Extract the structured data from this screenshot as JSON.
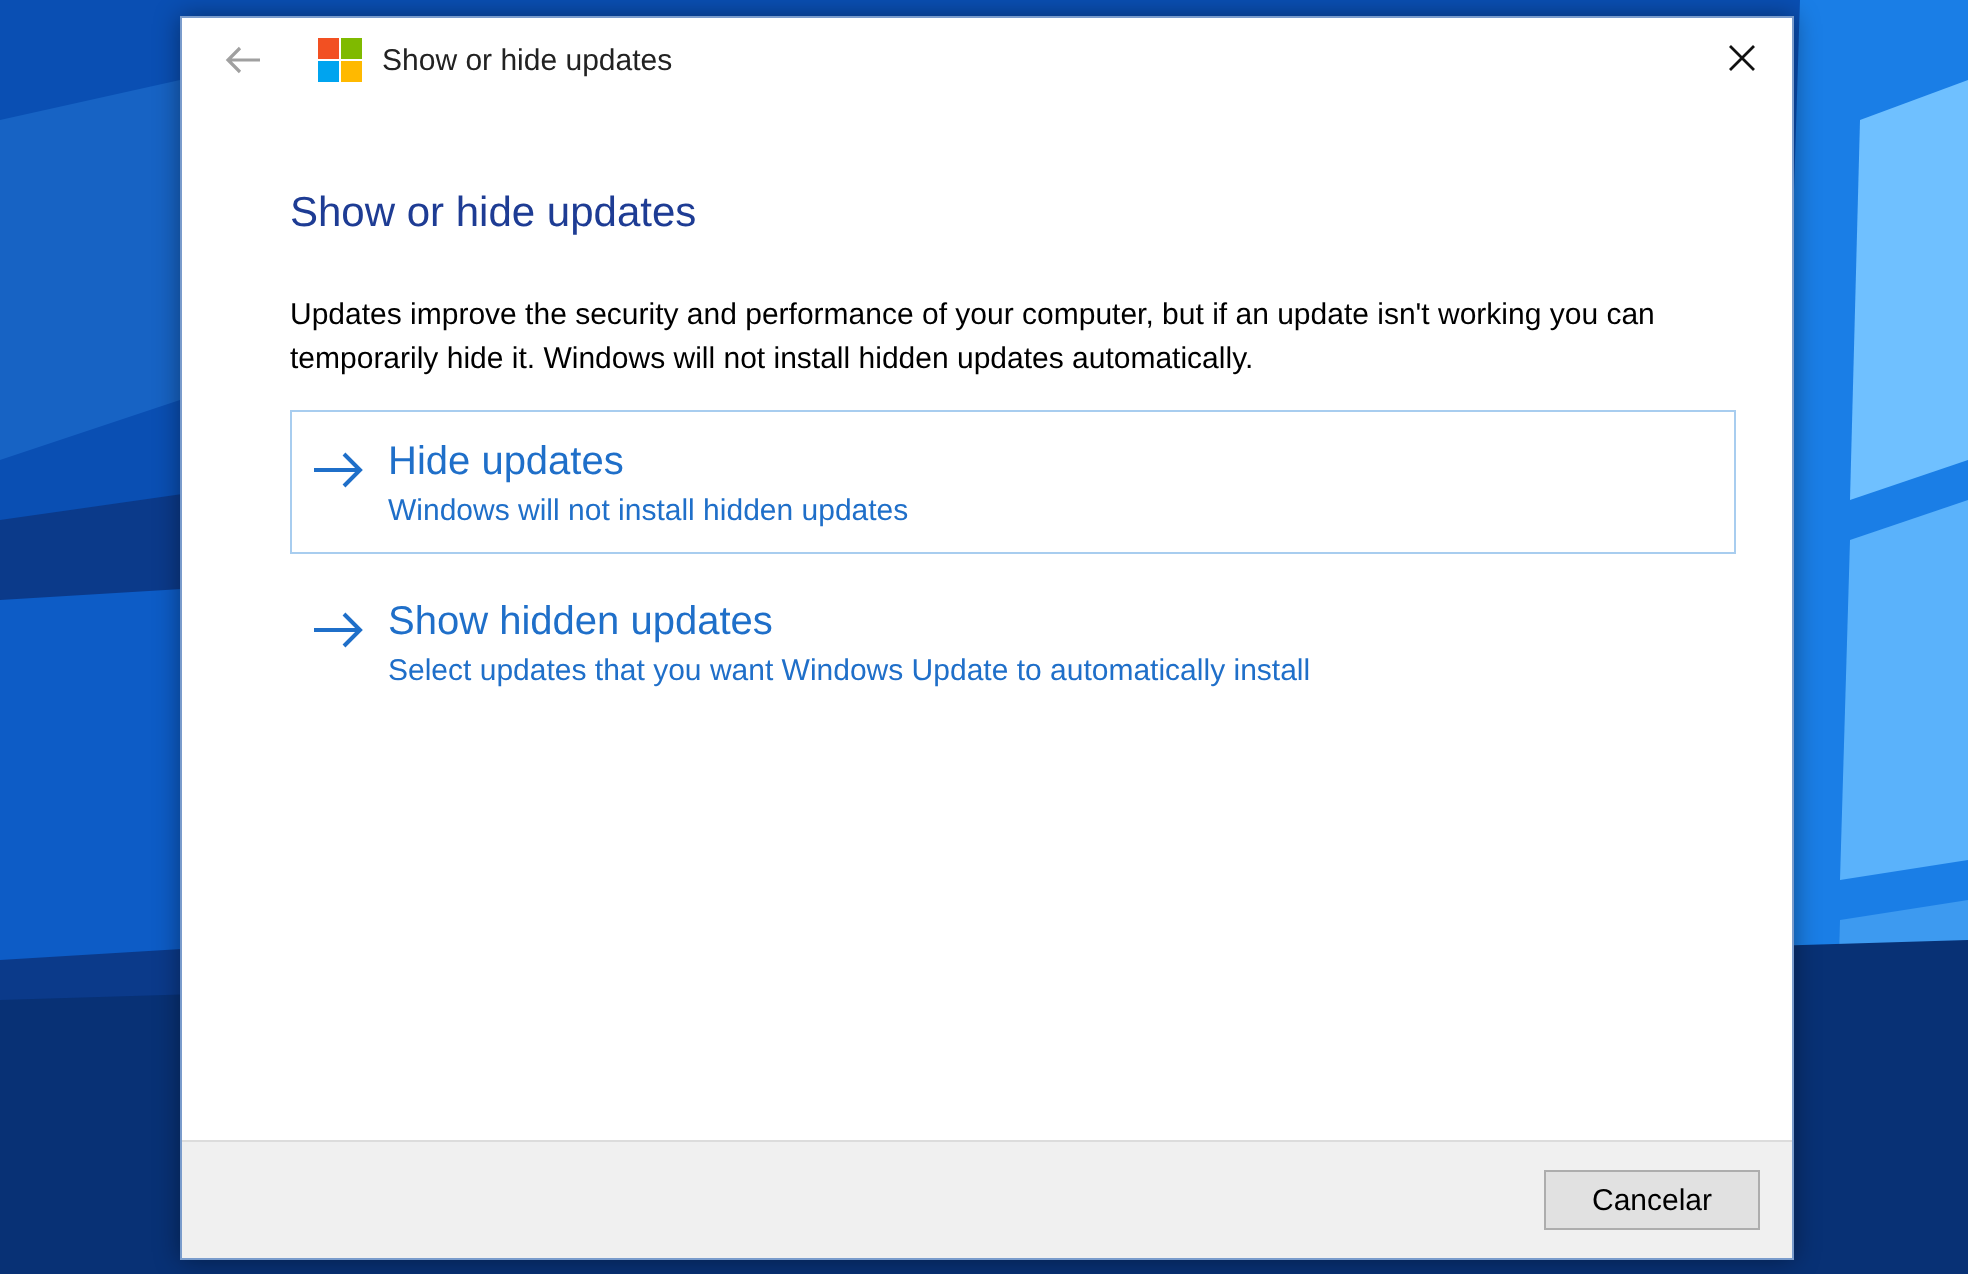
{
  "desktop": {
    "kind": "picture"
  },
  "window": {
    "title": "Show or hide updates"
  },
  "heading": "Show or hide updates",
  "description": "Updates improve the security and performance of your computer, but if an update isn't working you can temporarily hide it. Windows will not install hidden updates automatically.",
  "options": [
    {
      "title": "Hide updates",
      "subtitle": "Windows will not install hidden updates",
      "selected": true
    },
    {
      "title": "Show hidden updates",
      "subtitle": "Select updates that you want Windows Update to automatically install",
      "selected": false
    }
  ],
  "buttons": [
    "Cancelar"
  ]
}
